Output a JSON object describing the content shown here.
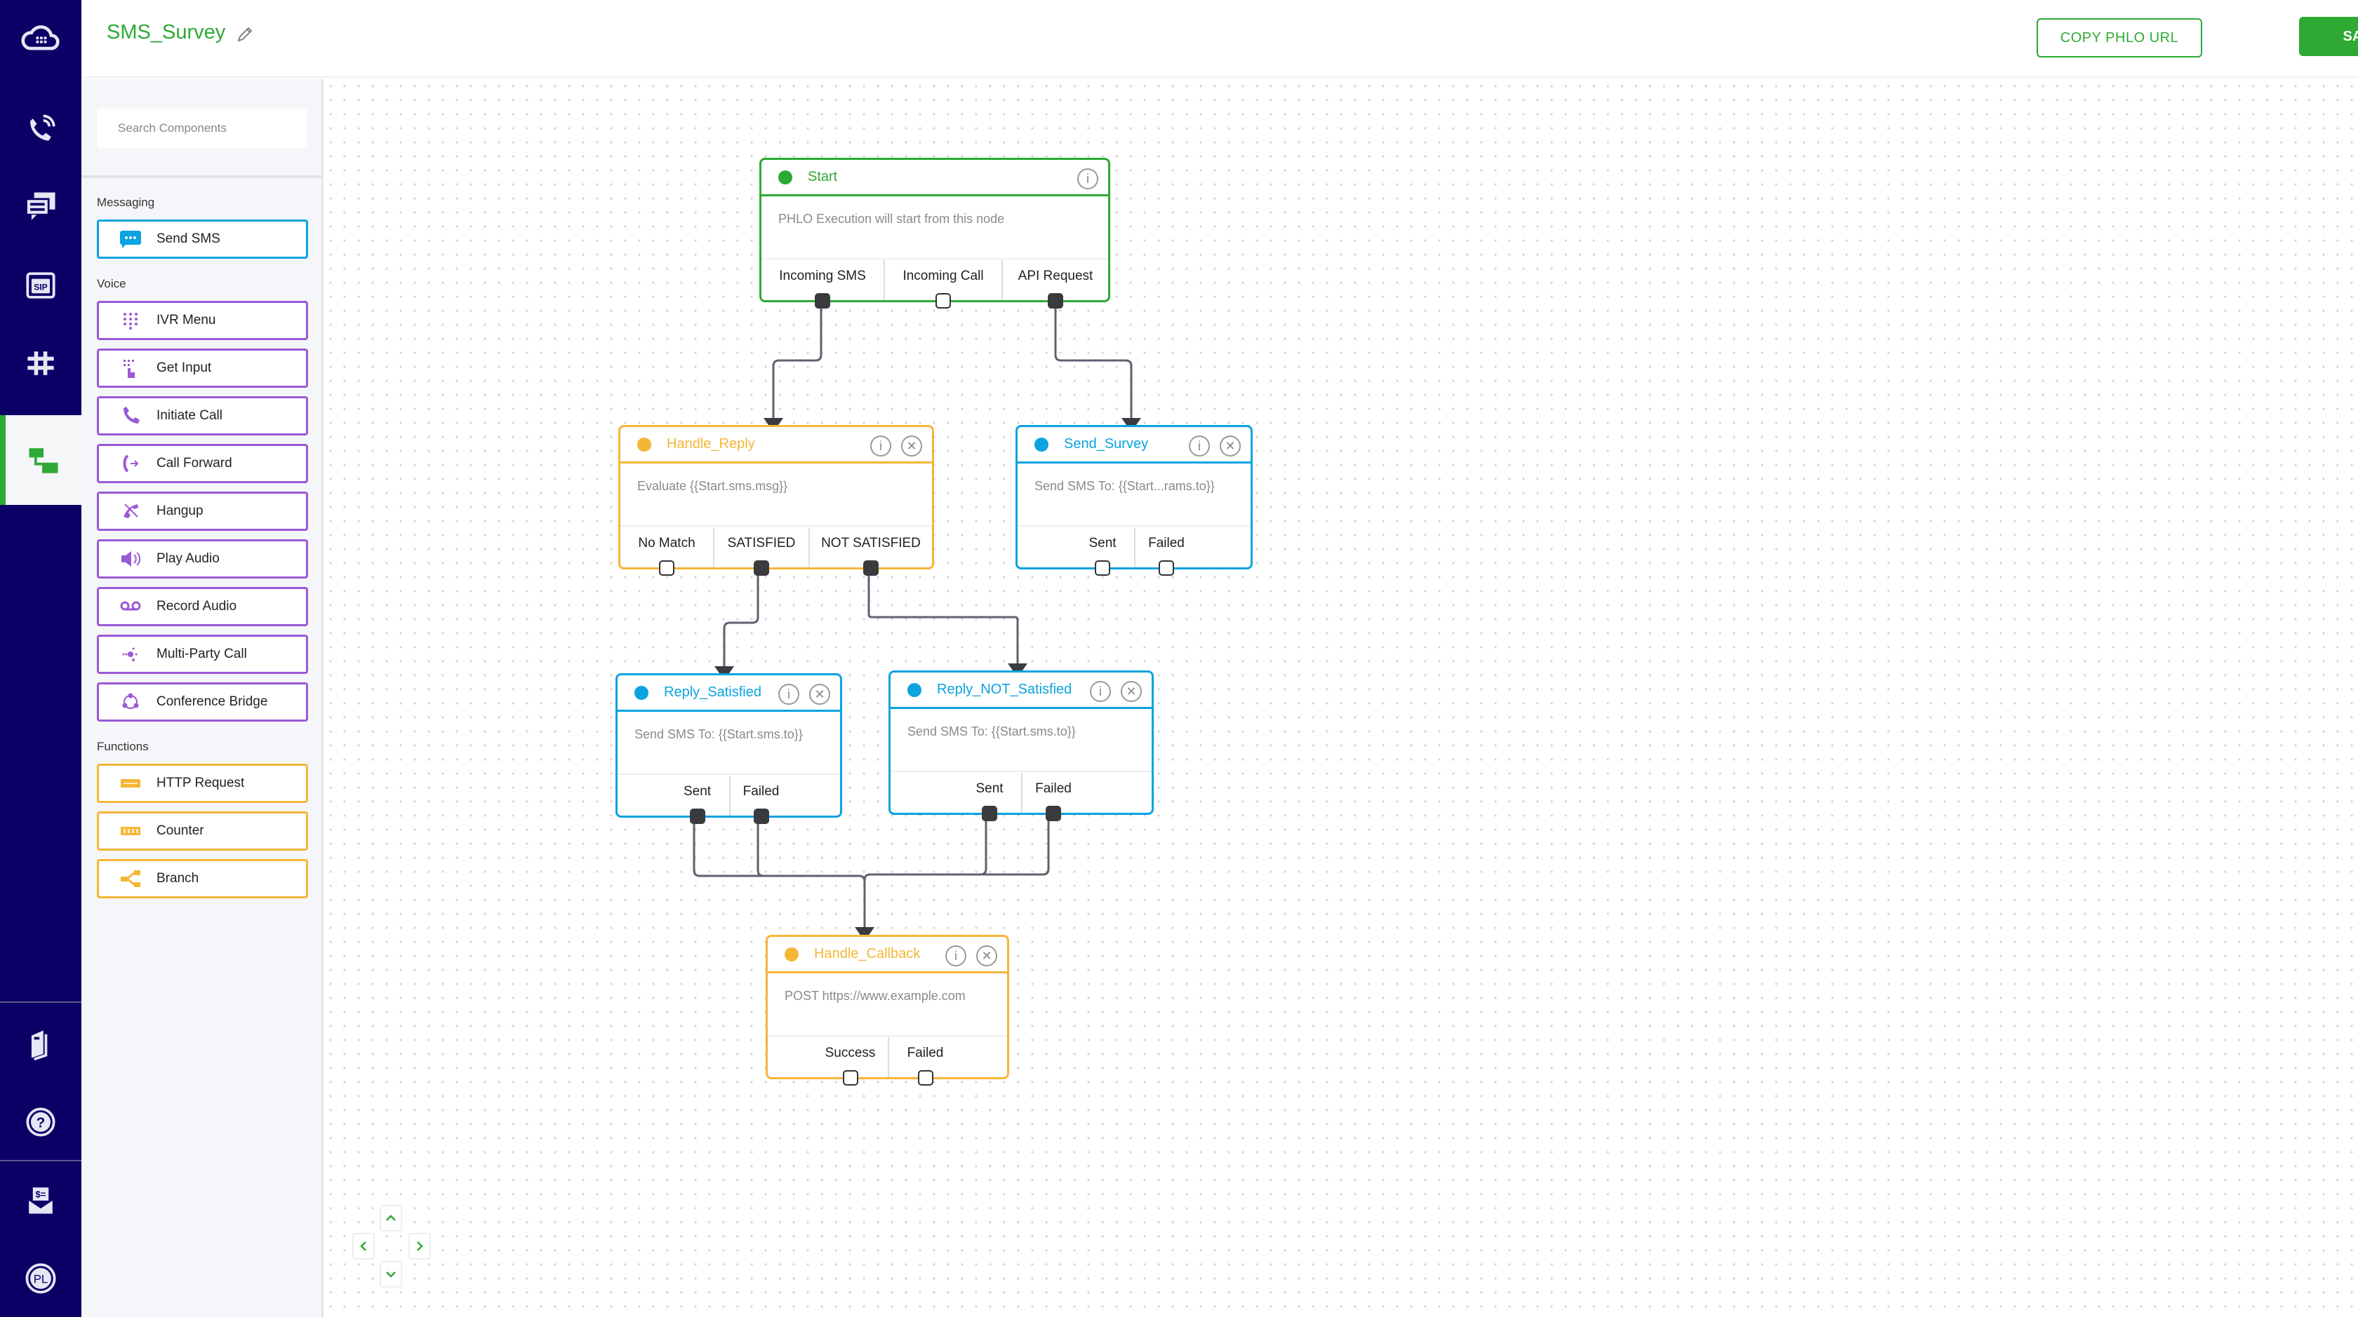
{
  "header": {
    "title": "SMS_Survey",
    "copy_button": "COPY PHLO URL",
    "save_button": "SAVE"
  },
  "rail": {
    "top_icons": [
      "cloud-logo-icon",
      "voice-calls-icon",
      "messaging-icon",
      "sip-icon",
      "phone-numbers-icon",
      "phlo-icon"
    ],
    "active": "phlo-icon",
    "bottom_icons": [
      "docs-icon",
      "help-icon",
      "billing-icon",
      "account-icon"
    ],
    "account_initials": "PL"
  },
  "panel": {
    "search_placeholder": "Search Components",
    "sections": [
      {
        "label": "Messaging",
        "items": [
          {
            "label": "Send SMS",
            "icon": "sms-icon"
          }
        ]
      },
      {
        "label": "Voice",
        "items": [
          {
            "label": "IVR Menu",
            "icon": "keypad-icon"
          },
          {
            "label": "Get Input",
            "icon": "get-input-icon"
          },
          {
            "label": "Initiate Call",
            "icon": "phone-icon"
          },
          {
            "label": "Call Forward",
            "icon": "call-forward-icon"
          },
          {
            "label": "Hangup",
            "icon": "hangup-icon"
          },
          {
            "label": "Play Audio",
            "icon": "speaker-icon"
          },
          {
            "label": "Record Audio",
            "icon": "voicemail-icon"
          },
          {
            "label": "Multi-Party Call",
            "icon": "multi-party-icon"
          },
          {
            "label": "Conference Bridge",
            "icon": "conference-icon"
          }
        ]
      },
      {
        "label": "Functions",
        "items": [
          {
            "label": "HTTP Request",
            "icon": "http-icon"
          },
          {
            "label": "Counter",
            "icon": "counter-icon"
          },
          {
            "label": "Branch",
            "icon": "branch-icon"
          }
        ]
      }
    ]
  },
  "colors": {
    "brand_green": "#2ea934",
    "rail_navy": "#0a0066",
    "messaging_blue": "#0ba3e0",
    "voice_purple": "#9b59d6",
    "function_orange": "#f5b638",
    "wire": "#5f6070"
  },
  "nodes": {
    "start": {
      "title": "Start",
      "body": "PHLO Execution will start from this node",
      "ports": [
        "Incoming SMS",
        "Incoming Call",
        "API Request"
      ]
    },
    "handle_reply": {
      "title": "Handle_Reply",
      "body": "Evaluate {{Start.sms.msg}}",
      "ports": [
        "No Match",
        "SATISFIED",
        "NOT SATISFIED"
      ]
    },
    "send_survey": {
      "title": "Send_Survey",
      "body": "Send SMS To: {{Start...rams.to}}",
      "ports": [
        "Sent",
        "Failed"
      ]
    },
    "reply_satisfied": {
      "title": "Reply_Satisfied",
      "body": "Send SMS To: {{Start.sms.to}}",
      "ports": [
        "Sent",
        "Failed"
      ]
    },
    "reply_not_satisfied": {
      "title": "Reply_NOT_Satisfied",
      "body": "Send SMS To: {{Start.sms.to}}",
      "ports": [
        "Sent",
        "Failed"
      ]
    },
    "handle_callback": {
      "title": "Handle_Callback",
      "body": "POST https://www.example.com",
      "ports": [
        "Success",
        "Failed"
      ]
    }
  },
  "nav": {
    "up": "^",
    "left": "<",
    "right": ">",
    "down": "v"
  }
}
